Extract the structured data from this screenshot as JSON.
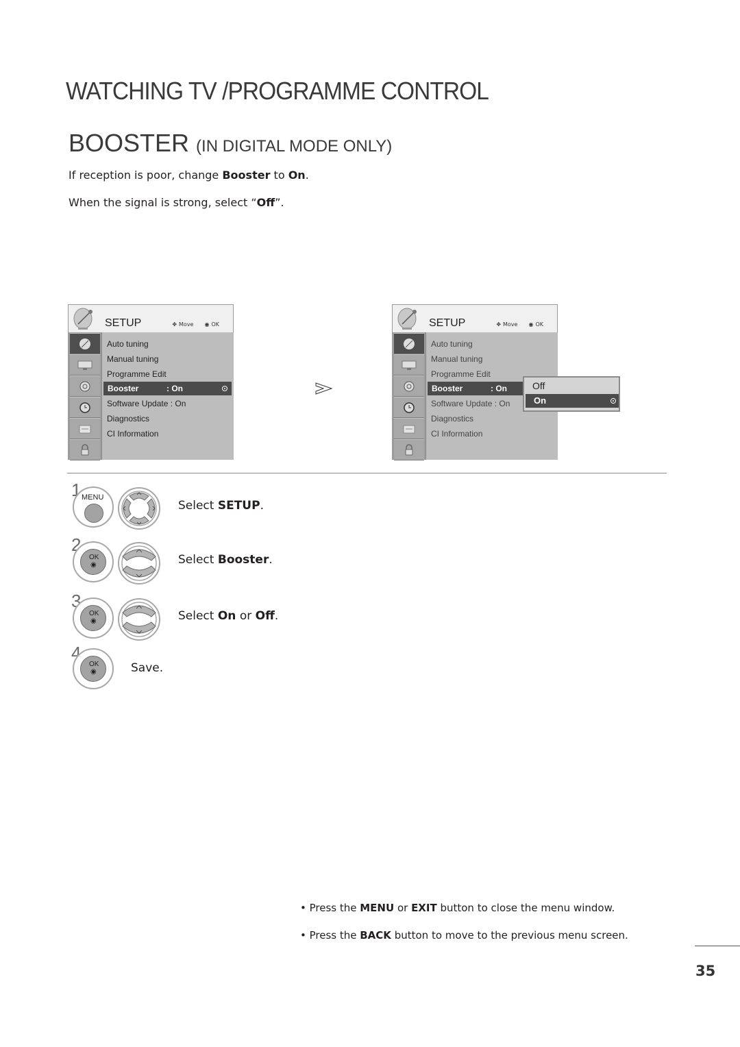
{
  "page": {
    "title": "WATCHING TV /PROGRAMME CONTROL",
    "section_title": "BOOSTER",
    "section_subtitle": "(IN DIGITAL MODE ONLY)",
    "intro": [
      {
        "pre": "If reception is poor, change ",
        "b1": "Booster",
        "mid": " to ",
        "b2": "On",
        "post": "."
      },
      {
        "pre": "When the signal is strong, select “",
        "b1": "Off",
        "post": "”."
      }
    ],
    "page_number": "35"
  },
  "osd_menus": [
    {
      "title": "SETUP",
      "hint_move": "Move",
      "hint_ok": "OK",
      "sidebar_icons": [
        "satellite-dish-icon",
        "tv-screen-icon",
        "speaker-icon",
        "clock-icon",
        "option-icon",
        "lock-icon"
      ],
      "items": [
        "Auto tuning",
        "Manual tuning",
        "Programme Edit",
        "Booster",
        "Software Update : On",
        "Diagnostics",
        "CI Information"
      ],
      "selected_label": "Booster",
      "selected_value": ": On"
    },
    {
      "title": "SETUP",
      "hint_move": "Move",
      "hint_ok": "OK",
      "items": [
        "Auto tuning",
        "Manual tuning",
        "Programme Edit",
        "Booster",
        "Software Update : On",
        "Diagnostics",
        "CI Information"
      ],
      "selected_label": "Booster",
      "selected_value": ": On",
      "popup_options": [
        "Off",
        "On"
      ],
      "popup_selected": "On"
    }
  ],
  "steps": [
    {
      "number": "1",
      "button_label": "MENU",
      "pre": "Select ",
      "bold": "SETUP",
      "post": "."
    },
    {
      "number": "2",
      "button_label": "OK",
      "pre": "Select ",
      "bold": "Booster",
      "post": "."
    },
    {
      "number": "3",
      "button_label": "OK",
      "pre": "Select ",
      "bold": "On",
      "mid": " or ",
      "bold2": "Off",
      "post": "."
    },
    {
      "number": "4",
      "button_label": "OK",
      "text": "Save."
    }
  ],
  "notes": [
    {
      "pre": "• Press the ",
      "b1": "MENU",
      "mid": " or ",
      "b2": "EXIT",
      "post": " button to close the menu window."
    },
    {
      "pre": "• Press the ",
      "b1": "BACK",
      "post": " button to move to the previous menu screen."
    }
  ]
}
